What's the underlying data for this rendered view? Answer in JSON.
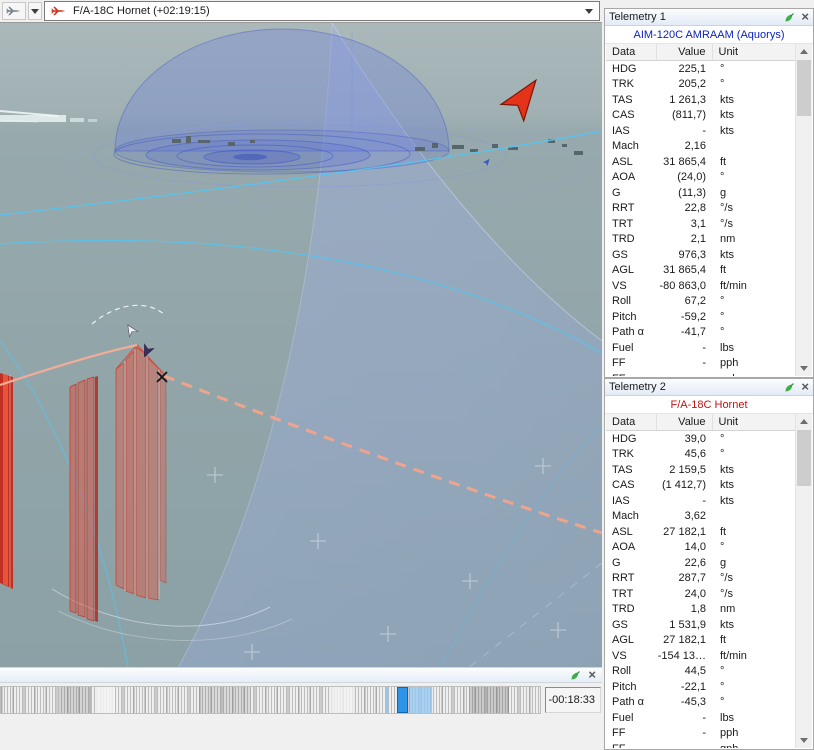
{
  "colors": {
    "panel1_title": "#0a1ec0",
    "panel2_title": "#c01414",
    "timeline_marker": "#2e95e6",
    "selected_arrow": "#e5331a"
  },
  "icons": {
    "close": "×"
  },
  "toolbar": {
    "object_selector": {
      "label": "F/A-18C Hornet (+02:19:15)"
    }
  },
  "timeline": {
    "current_time": "-00:18:33"
  },
  "panels": [
    {
      "title": "Telemetry 1",
      "subtitle": "AIM-120C AMRAAM (Aquorys)",
      "subtitle_color": "#0a1ec0",
      "columns": [
        "Data",
        "Value",
        "Unit"
      ],
      "rows": [
        [
          "HDG",
          "225,1",
          "°"
        ],
        [
          "TRK",
          "205,2",
          "°"
        ],
        [
          "TAS",
          "1 261,3",
          "kts"
        ],
        [
          "CAS",
          "(811,7)",
          "kts"
        ],
        [
          "IAS",
          "-",
          "kts"
        ],
        [
          "Mach",
          "2,16",
          ""
        ],
        [
          "ASL",
          "31 865,4",
          "ft"
        ],
        [
          "AOA",
          "(24,0)",
          "°"
        ],
        [
          "G",
          "(11,3)",
          "g"
        ],
        [
          "RRT",
          "22,8",
          "°/s"
        ],
        [
          "TRT",
          "3,1",
          "°/s"
        ],
        [
          "TRD",
          "2,1",
          "nm"
        ],
        [
          "GS",
          "976,3",
          "kts"
        ],
        [
          "AGL",
          "31 865,4",
          "ft"
        ],
        [
          "VS",
          "-80 863,0",
          "ft/min"
        ],
        [
          "Roll",
          "67,2",
          "°"
        ],
        [
          "Pitch",
          "-59,2",
          "°"
        ],
        [
          "Path α",
          "-41,7",
          "°"
        ],
        [
          "Fuel",
          "-",
          "lbs"
        ],
        [
          "FF",
          "-",
          "pph"
        ],
        [
          "FF",
          "-",
          "gph"
        ]
      ]
    },
    {
      "title": "Telemetry 2",
      "subtitle": "F/A-18C Hornet",
      "subtitle_color": "#c01414",
      "columns": [
        "Data",
        "Value",
        "Unit"
      ],
      "rows": [
        [
          "HDG",
          "39,0",
          "°"
        ],
        [
          "TRK",
          "45,6",
          "°"
        ],
        [
          "TAS",
          "2 159,5",
          "kts"
        ],
        [
          "CAS",
          "(1 412,7)",
          "kts"
        ],
        [
          "IAS",
          "-",
          "kts"
        ],
        [
          "Mach",
          "3,62",
          ""
        ],
        [
          "ASL",
          "27 182,1",
          "ft"
        ],
        [
          "AOA",
          "14,0",
          "°"
        ],
        [
          "G",
          "22,6",
          "g"
        ],
        [
          "RRT",
          "287,7",
          "°/s"
        ],
        [
          "TRT",
          "24,0",
          "°/s"
        ],
        [
          "TRD",
          "1,8",
          "nm"
        ],
        [
          "GS",
          "1 531,9",
          "kts"
        ],
        [
          "AGL",
          "27 182,1",
          "ft"
        ],
        [
          "VS",
          "-154 13…",
          "ft/min"
        ],
        [
          "Roll",
          "44,5",
          "°"
        ],
        [
          "Pitch",
          "-22,1",
          "°"
        ],
        [
          "Path α",
          "-45,3",
          "°"
        ],
        [
          "Fuel",
          "-",
          "lbs"
        ],
        [
          "FF",
          "-",
          "pph"
        ],
        [
          "FF",
          "-",
          "gph"
        ]
      ]
    }
  ]
}
